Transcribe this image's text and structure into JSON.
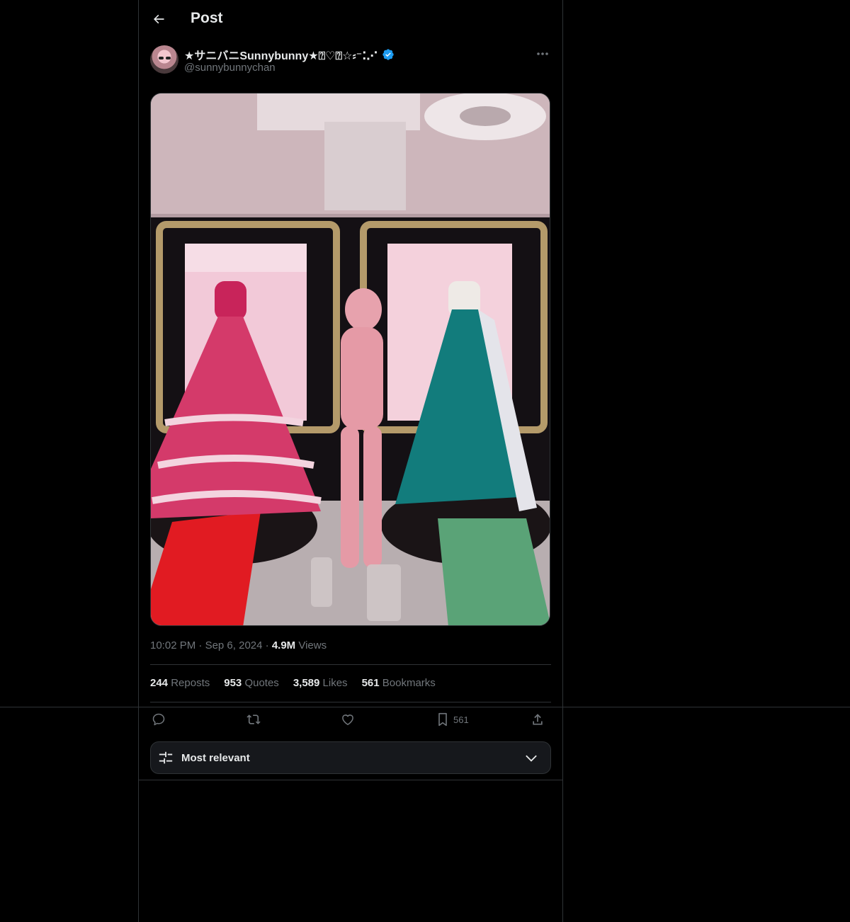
{
  "header": {
    "title": "Post",
    "back_icon": "arrow-left-icon"
  },
  "author": {
    "display_name": "★サニバニSunnybunny★⍰♡⍰☆⸗⁻⁚⋰",
    "handle": "@sunnybunnychan",
    "verified_icon": "verified-badge-icon",
    "more_icon": "more-dots-icon"
  },
  "post": {
    "time": "10:02 PM",
    "date": "Sep 6, 2024",
    "views_count": "4.9M",
    "views_label": "Views"
  },
  "stats": {
    "reposts_count": "244",
    "reposts_label": "Reposts",
    "quotes_count": "953",
    "quotes_label": "Quotes",
    "likes_count": "3,589",
    "likes_label": "Likes",
    "bookmarks_count": "561",
    "bookmarks_label": "Bookmarks"
  },
  "actions": {
    "reply_icon": "reply-icon",
    "repost_icon": "repost-icon",
    "like_icon": "heart-icon",
    "bookmark_icon": "bookmark-icon",
    "bookmark_count": "561",
    "share_icon": "share-icon"
  },
  "sort": {
    "label": "Most relevant",
    "icon": "sliders-icon",
    "chevron": "chevron-down-icon"
  },
  "colors": {
    "background": "#000000",
    "accent": "#1d9bf0",
    "muted": "#71767b",
    "border": "#2f3336"
  }
}
